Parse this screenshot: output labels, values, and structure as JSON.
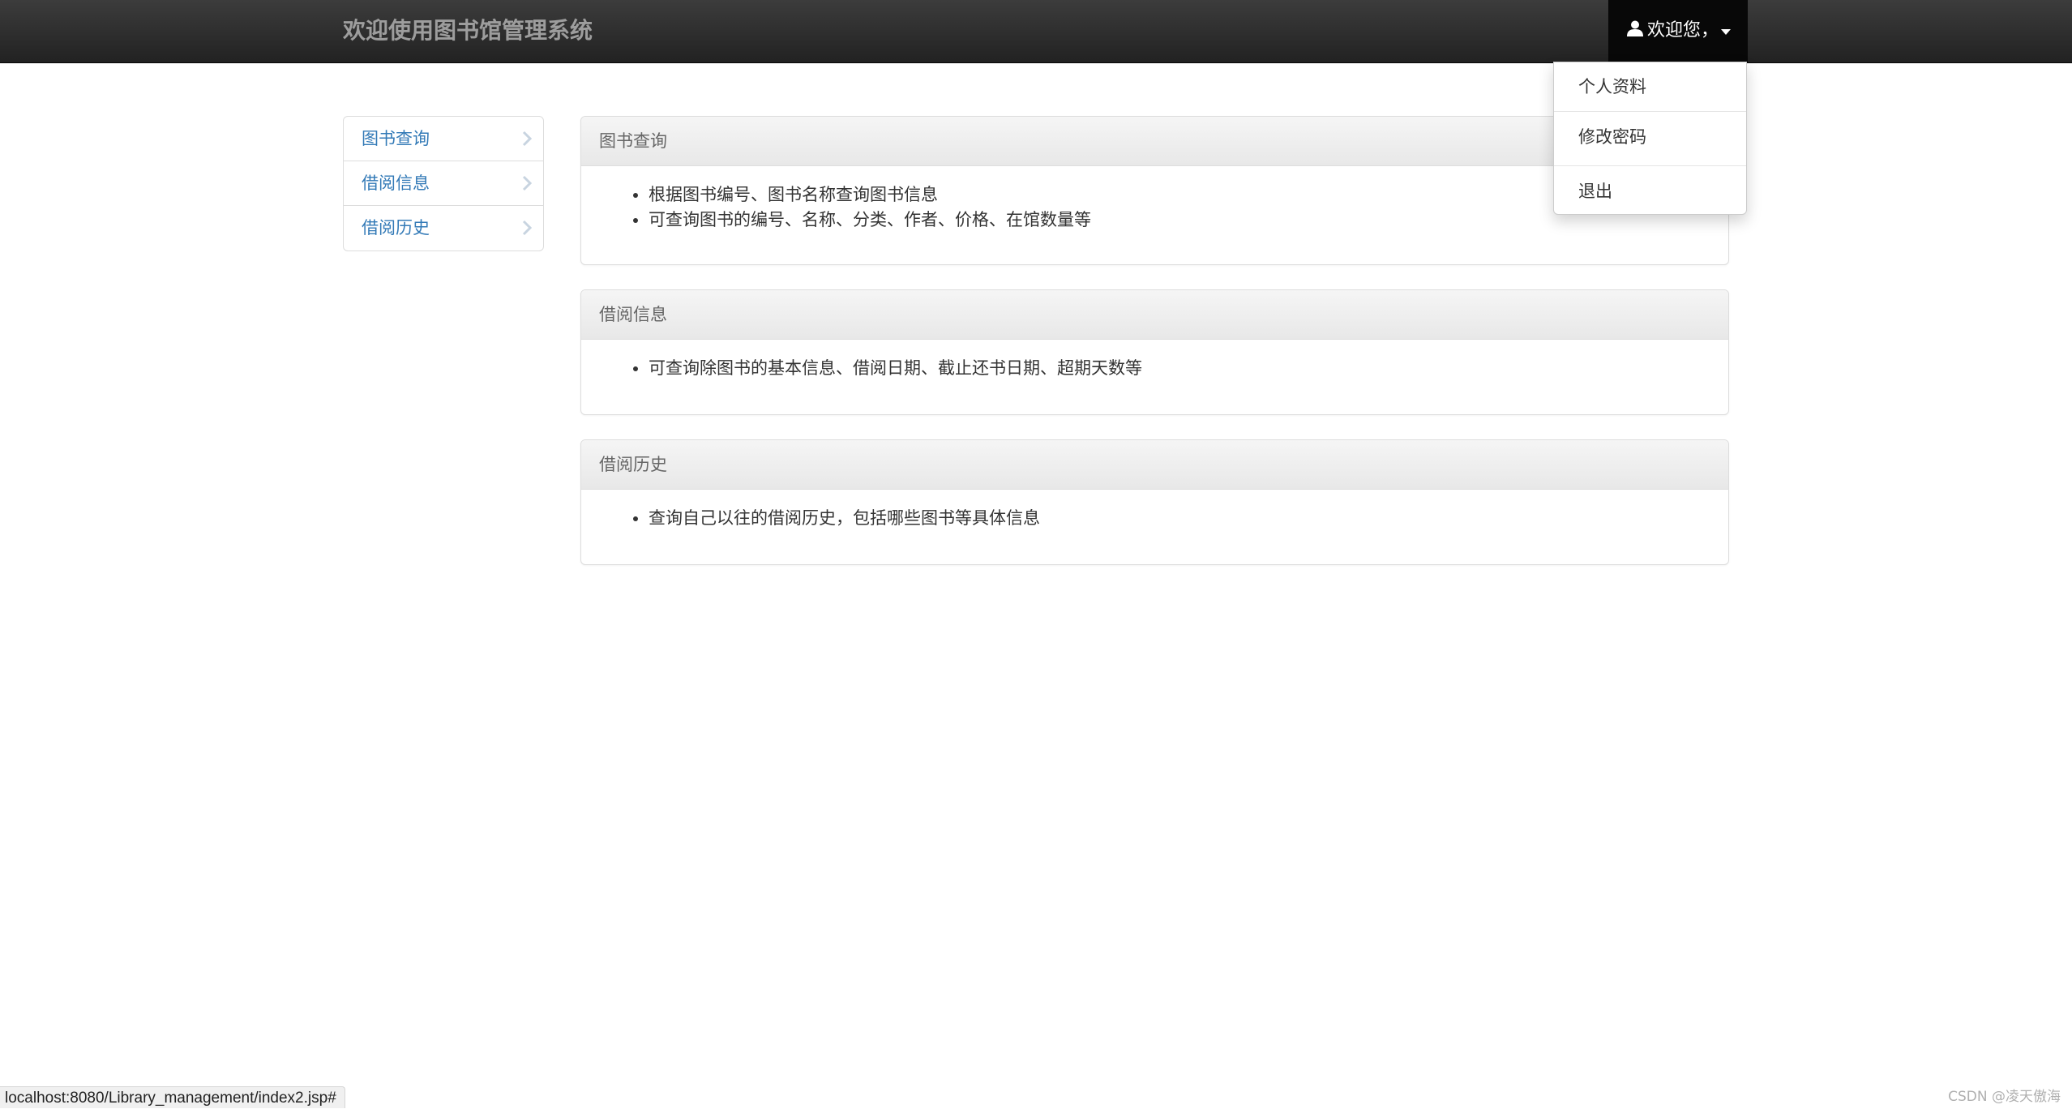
{
  "navbar": {
    "brand": "欢迎使用图书馆管理系统",
    "user_menu_label": "欢迎您，",
    "user_icon": "user-icon",
    "caret_icon": "caret-down-icon"
  },
  "dropdown": {
    "items": [
      {
        "label": "个人资料"
      },
      {
        "label": "修改密码"
      },
      {
        "label": "退出"
      }
    ]
  },
  "sidebar": {
    "chevron_icon": "chevron-right-icon",
    "items": [
      {
        "label": "图书查询"
      },
      {
        "label": "借阅信息"
      },
      {
        "label": "借阅历史"
      }
    ]
  },
  "panels": [
    {
      "title": "图书查询",
      "bullets": [
        "根据图书编号、图书名称查询图书信息",
        "可查询图书的编号、名称、分类、作者、价格、在馆数量等"
      ]
    },
    {
      "title": "借阅信息",
      "bullets": [
        "可查询除图书的基本信息、借阅日期、截止还书日期、超期天数等"
      ]
    },
    {
      "title": "借阅历史",
      "bullets": [
        "查询自己以往的借阅历史，包括哪些图书等具体信息"
      ]
    }
  ],
  "status_bar": {
    "url": "localhost:8080/Library_management/index2.jsp#"
  },
  "watermark": "CSDN @凌天傲海",
  "colors": {
    "navbar_bg": "#222222",
    "link": "#337ab7",
    "panel_heading_bg": "#f5f5f5"
  }
}
